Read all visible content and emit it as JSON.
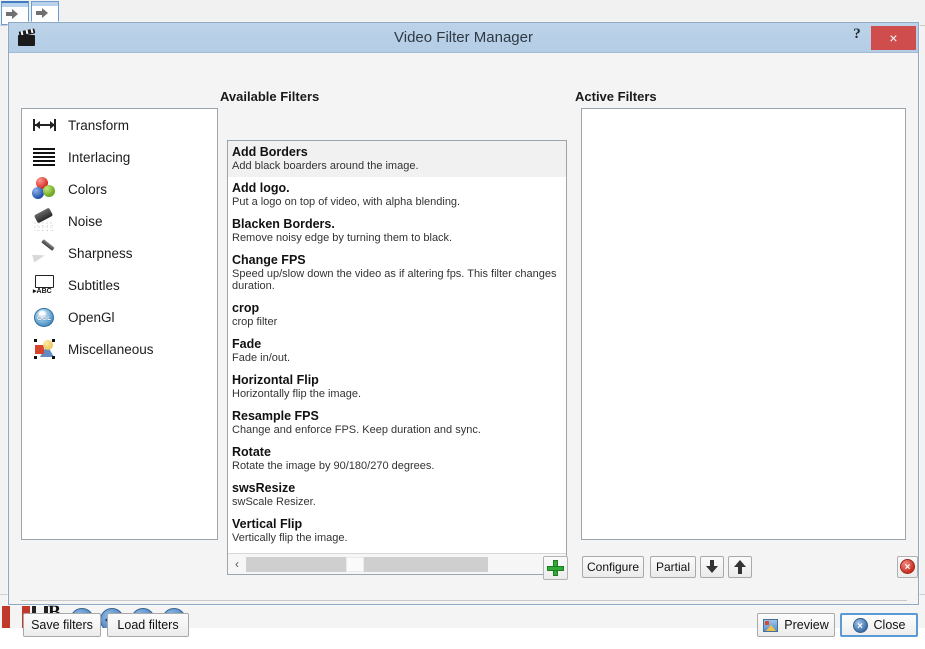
{
  "window": {
    "title": "Video Filter Manager",
    "title_icon": "film-slate-icon",
    "help_label": "?",
    "close_label": "×"
  },
  "panels": {
    "available_header": "Available Filters",
    "active_header": "Active Filters"
  },
  "categories": [
    {
      "label": "Transform",
      "icon": "transform-icon"
    },
    {
      "label": "Interlacing",
      "icon": "interlacing-icon"
    },
    {
      "label": "Colors",
      "icon": "colors-icon"
    },
    {
      "label": "Noise",
      "icon": "noise-icon"
    },
    {
      "label": "Sharpness",
      "icon": "sharpness-icon"
    },
    {
      "label": "Subtitles",
      "icon": "subtitles-icon"
    },
    {
      "label": "OpenGl",
      "icon": "opengl-icon"
    },
    {
      "label": "Miscellaneous",
      "icon": "miscellaneous-icon"
    }
  ],
  "available_filters": [
    {
      "name": "Add Borders",
      "desc": "Add black boarders around the image.",
      "selected": true
    },
    {
      "name": "Add logo.",
      "desc": "Put a logo on top of video, with alpha blending.",
      "selected": false
    },
    {
      "name": "Blacken Borders.",
      "desc": "Remove noisy edge by turning them to black.",
      "selected": false
    },
    {
      "name": "Change FPS",
      "desc": "Speed up/slow down the video as if altering fps. This filter changes duration.",
      "selected": false
    },
    {
      "name": "crop",
      "desc": "crop filter",
      "selected": false
    },
    {
      "name": "Fade",
      "desc": "Fade in/out.",
      "selected": false
    },
    {
      "name": "Horizontal Flip",
      "desc": "Horizontally flip the image.",
      "selected": false
    },
    {
      "name": "Resample FPS",
      "desc": "Change and enforce FPS. Keep duration and sync.",
      "selected": false
    },
    {
      "name": "Rotate",
      "desc": "Rotate the image by 90/180/270 degrees.",
      "selected": false
    },
    {
      "name": "swsResize",
      "desc": "swScale Resizer.",
      "selected": false
    },
    {
      "name": "Vertical Flip",
      "desc": "Vertically flip the image.",
      "selected": false
    }
  ],
  "active_filters": [],
  "scrollbar": {
    "left_arrow": "‹",
    "right_arrow": "›"
  },
  "toolbar": {
    "add_label": "",
    "configure_label": "Configure",
    "partial_label": "Partial",
    "move_down_label": "",
    "move_up_label": "",
    "delete_label": "×"
  },
  "bottom": {
    "save_label": "Save filters",
    "load_label": "Load filters",
    "preview_label": "Preview",
    "close_label": "Close",
    "close_icon_glyph": "×"
  },
  "background": {
    "opengl_badge": "OGL",
    "taskbar_letter": "B"
  },
  "colors": {
    "titlebar": "#b8d0e6",
    "close_red": "#cf4d4d",
    "dialog_bg": "#f4f4f4",
    "panel_border": "#9aa5ad",
    "selection": "#f1f1f1",
    "accent_blue": "#5b9bd5",
    "add_green": "#2faa35",
    "delete_red": "#cc2f22"
  }
}
